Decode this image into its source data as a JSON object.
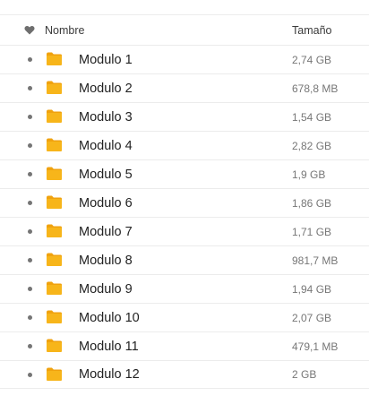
{
  "header": {
    "favorite_icon": "heart-icon",
    "name_label": "Nombre",
    "size_label": "Tamaño"
  },
  "colors": {
    "folder": "#f7b51a",
    "folder_tab": "#f0a20e",
    "bullet": "#757575"
  },
  "files": [
    {
      "name": "Modulo 1",
      "size": "2,74 GB",
      "icon": "folder-icon"
    },
    {
      "name": "Modulo 2",
      "size": "678,8 MB",
      "icon": "folder-icon"
    },
    {
      "name": "Modulo 3",
      "size": "1,54 GB",
      "icon": "folder-icon"
    },
    {
      "name": "Modulo 4",
      "size": "2,82 GB",
      "icon": "folder-icon"
    },
    {
      "name": "Modulo 5",
      "size": "1,9 GB",
      "icon": "folder-icon"
    },
    {
      "name": "Modulo 6",
      "size": "1,86 GB",
      "icon": "folder-icon"
    },
    {
      "name": "Modulo 7",
      "size": "1,71 GB",
      "icon": "folder-icon"
    },
    {
      "name": "Modulo 8",
      "size": "981,7 MB",
      "icon": "folder-icon"
    },
    {
      "name": "Modulo 9",
      "size": "1,94 GB",
      "icon": "folder-icon"
    },
    {
      "name": "Modulo 10",
      "size": "2,07 GB",
      "icon": "folder-icon"
    },
    {
      "name": "Modulo 11",
      "size": "479,1 MB",
      "icon": "folder-icon"
    },
    {
      "name": "Modulo 12",
      "size": "2 GB",
      "icon": "folder-icon"
    }
  ]
}
